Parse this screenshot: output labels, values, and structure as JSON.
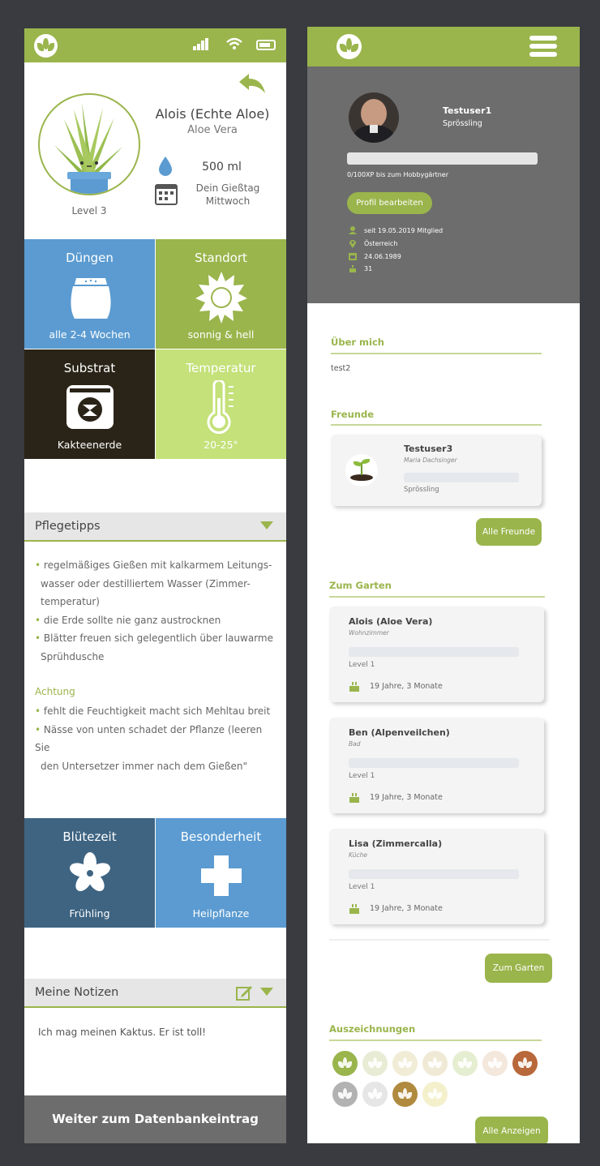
{
  "colors": {
    "accent": "#9ab54c",
    "blue": "#5b9bd1",
    "dark": "#2a2418",
    "light_green": "#c4e17a",
    "steel": "#3e6482",
    "gray": "#6d6d6d"
  },
  "plant": {
    "name": "Alois (Echte Aloe)",
    "species": "Aloe Vera",
    "level": "Level 3",
    "water_amount": "500 ml",
    "water_day_label": "Dein Gießtag",
    "water_day": "Mittwoch"
  },
  "tiles": [
    {
      "title": "Düngen",
      "value": "alle 2-4 Wochen",
      "icon": "fertilizer-bag-icon"
    },
    {
      "title": "Standort",
      "value": "sonnig & hell",
      "icon": "sun-icon"
    },
    {
      "title": "Substrat",
      "value": "Kakteenerde",
      "icon": "soil-bag-icon"
    },
    {
      "title": "Temperatur",
      "value": "20-25°",
      "icon": "thermometer-icon"
    }
  ],
  "care": {
    "title": "Pflegetipps",
    "tips": [
      [
        "regelmäßiges Gießen mit kalkarmem Leitungs-",
        "wasser oder destilliertem Wasser (Zimmer-",
        "temperatur)"
      ],
      [
        "die Erde sollte nie ganz austrocknen"
      ],
      [
        "Blätter freuen sich gelegentlich über lauwarme",
        "Sprühdusche"
      ]
    ],
    "warning_title": "Achtung",
    "warnings": [
      [
        "fehlt die Feuchtigkeit macht sich Mehltau breit"
      ],
      [
        "Nässe von unten schadet der Pflanze (leeren Sie",
        "den Untersetzer immer nach dem Gießen\""
      ]
    ]
  },
  "tiles2": [
    {
      "title": "Blütezeit",
      "value": "Frühling",
      "icon": "flower-icon"
    },
    {
      "title": "Besonderheit",
      "value": "Heilpflanze",
      "icon": "cross-icon"
    }
  ],
  "notes": {
    "title": "Meine Notizen",
    "text": "Ich mag meinen Kaktus. Er ist toll!"
  },
  "db_button": "Weiter zum Datenbankeintrag",
  "profile": {
    "username": "Testuser1",
    "rank": "Sprössling",
    "xp": "0/100XP bis zum Hobbygärtner",
    "xp_progress": 0,
    "edit_button": "Profil bearbeiten",
    "info": [
      {
        "icon": "user-icon",
        "text": "seit 19.05.2019 Mitglied"
      },
      {
        "icon": "location-pin-icon",
        "text": "Österreich"
      },
      {
        "icon": "calendar-icon",
        "text": "24.06.1989"
      },
      {
        "icon": "cake-icon",
        "text": "31"
      }
    ]
  },
  "about": {
    "title": "Über mich",
    "text": "test2"
  },
  "friends": {
    "title": "Freunde",
    "items": [
      {
        "name": "Testuser3",
        "fullname": "Maria Dachsinger",
        "rank": "Sprössling"
      }
    ],
    "button": "Alle Freunde"
  },
  "garden": {
    "title": "Zum Garten",
    "items": [
      {
        "name": "Alois (Aloe Vera)",
        "room": "Wohnzimmer",
        "level": "Level 1",
        "age": "19 Jahre, 3 Monate"
      },
      {
        "name": "Ben (Alpenveilchen)",
        "room": "Bad",
        "level": "Level 1",
        "age": "19 Jahre, 3 Monate"
      },
      {
        "name": "Lisa (Zimmercalla)",
        "room": "Küche",
        "level": "Level 1",
        "age": "19 Jahre, 3 Monate"
      }
    ],
    "button": "Zum Garten"
  },
  "awards": {
    "title": "Auszeichnungen",
    "button": "Alle Anzeigen",
    "badges": [
      "#9ab54c",
      "#e9ecd4",
      "#f0ecd6",
      "#efe9d5",
      "#e5eed0",
      "#f4e7dc",
      "#b8683a",
      "#b2b2b2",
      "#e6e6e6",
      "#b08a3e",
      "#f4f0cc"
    ]
  }
}
